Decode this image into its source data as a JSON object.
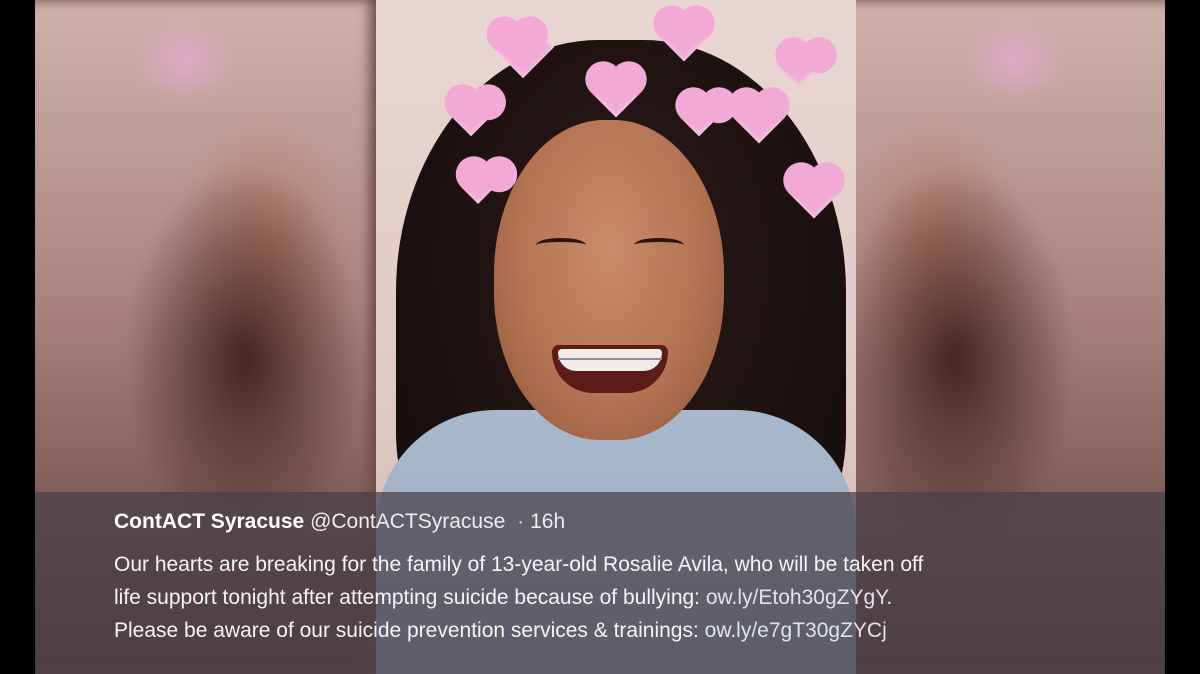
{
  "tweet": {
    "display_name": "ContACT Syracuse",
    "handle": "@ContACTSyracuse",
    "separator": "·",
    "time": "16h",
    "text_line1": "Our hearts are breaking for the family of 13-year-old Rosalie Avila, who will be taken off",
    "text_line2_pre": "life support tonight after attempting suicide because of bullying: ",
    "link1": "ow.ly/Etoh30gZYgY",
    "text_line2_post": ".",
    "text_line3_pre": "Please be aware of our suicide prevention services & trainings: ",
    "link2": "ow.ly/e7gT30gZYCj"
  },
  "photo": {
    "subject": "smiling girl with braces and heart-filter crown",
    "heart_color": "#f2a9d6"
  }
}
